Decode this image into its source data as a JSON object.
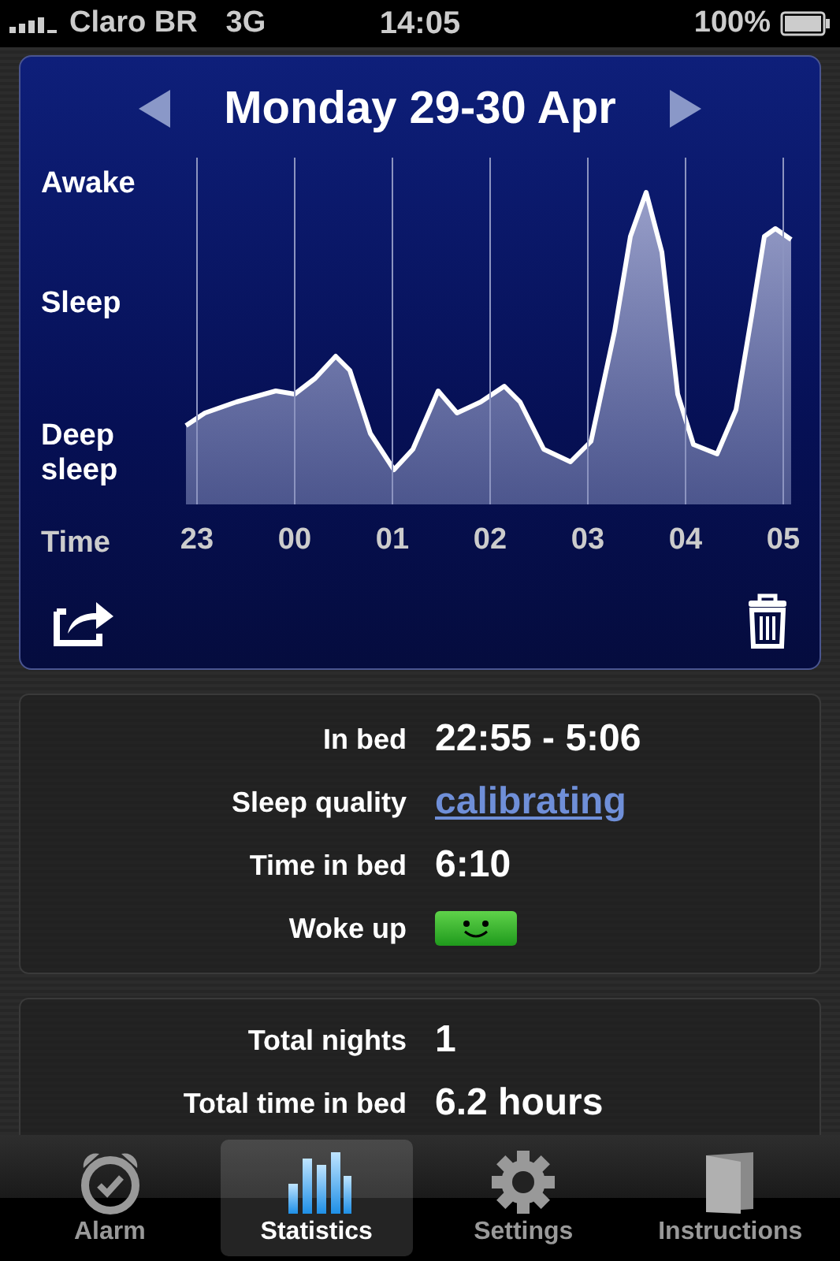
{
  "status_bar": {
    "carrier": "Claro BR",
    "network": "3G",
    "time": "14:05",
    "battery": "100%"
  },
  "night": {
    "title": "Monday 29-30 Apr",
    "y_labels": [
      "Awake",
      "Sleep",
      "Deep sleep"
    ],
    "x_title": "Time",
    "x_labels": [
      "23",
      "00",
      "01",
      "02",
      "03",
      "04",
      "05"
    ]
  },
  "summary": [
    {
      "label": "In bed",
      "value": "22:55 - 5:06",
      "kind": "text"
    },
    {
      "label": "Sleep quality",
      "value": "calibrating",
      "kind": "link"
    },
    {
      "label": "Time in bed",
      "value": "6:10",
      "kind": "text"
    },
    {
      "label": "Woke up",
      "kind": "mood"
    }
  ],
  "totals": [
    {
      "label": "Total nights",
      "value": "1"
    },
    {
      "label": "Total time in bed",
      "value": "6.2 hours"
    }
  ],
  "tabs": [
    {
      "label": "Alarm",
      "selected": false
    },
    {
      "label": "Statistics",
      "selected": true
    },
    {
      "label": "Settings",
      "selected": false
    },
    {
      "label": "Instructions",
      "selected": false
    }
  ]
}
